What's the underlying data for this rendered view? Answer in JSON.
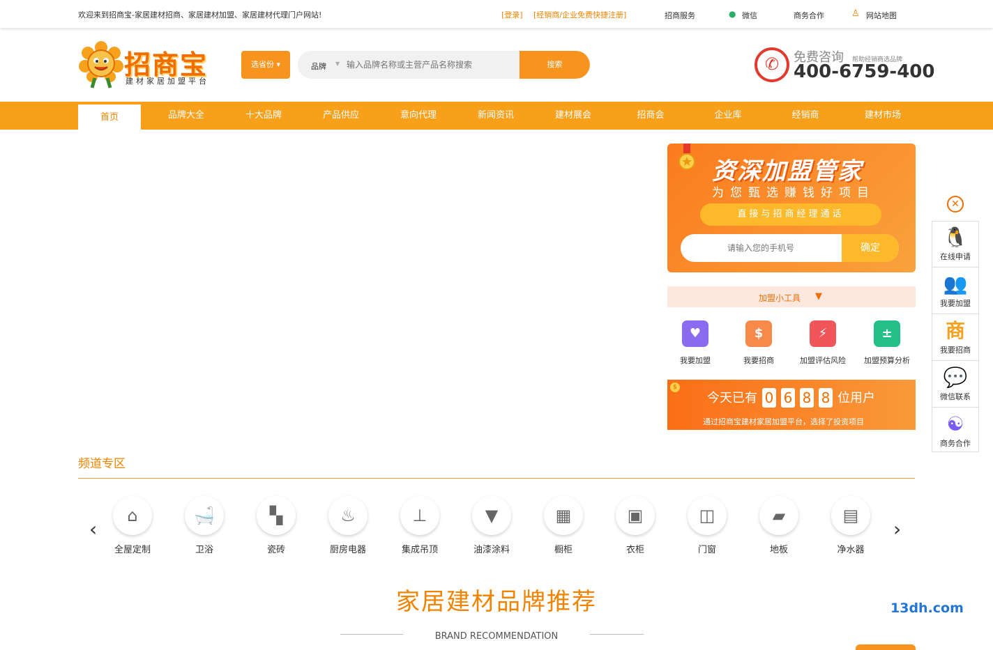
{
  "topbar": {
    "welcome": "欢迎来到招商宝-家居建材招商、家居建材加盟、家居建材代理门户网站!",
    "login": "[登录]",
    "register": "[经销商/企业免费快捷注册]",
    "service": "招商服务",
    "wechat": "微信",
    "business": "商务合作",
    "sitemap": "网站地图"
  },
  "logo": {
    "main": "招商宝",
    "sub": "建材家居加盟平台"
  },
  "search": {
    "province_label": "选省份 ▾",
    "category": "品牌",
    "placeholder": "输入品牌名称或主营产品名称搜索",
    "button": "搜索"
  },
  "hotline": {
    "label": "免费咨询",
    "slogan": "帮助经销商选品牌",
    "number": "400-6759-400"
  },
  "nav": [
    "首页",
    "品牌大全",
    "十大品牌",
    "产品供应",
    "意向代理",
    "新闻资讯",
    "建材展会",
    "招商会",
    "企业库",
    "经销商",
    "建材市场"
  ],
  "promo": {
    "title": "资深加盟管家",
    "subtitle": "为您甄选赚钱好项目",
    "pill": "直接与招商经理通话",
    "phone_placeholder": "请输入您的手机号",
    "confirm": "确定"
  },
  "tools": {
    "header": "加盟小工具",
    "items": [
      {
        "label": "我要加盟",
        "icon": "handshake-icon",
        "color": "#8b6cf0"
      },
      {
        "label": "我要招商",
        "icon": "money-bag-icon",
        "color": "#f7894a"
      },
      {
        "label": "加盟评估风险",
        "icon": "shield-icon",
        "color": "#f0555a"
      },
      {
        "label": "加盟预算分析",
        "icon": "calculator-icon",
        "color": "#25c08a"
      }
    ]
  },
  "counter": {
    "prefix": "今天已有",
    "digits": [
      "0",
      "6",
      "8",
      "8"
    ],
    "suffix": "位用户",
    "note": "通过招商宝建材家居加盟平台，选择了投资项目"
  },
  "sidebar": [
    {
      "label": "在线申请",
      "icon": "qq-penguin-icon"
    },
    {
      "label": "我要加盟",
      "icon": "group-icon"
    },
    {
      "label": "我要招商",
      "icon": "shang-char-icon"
    },
    {
      "label": "微信联系",
      "icon": "wechat-icon"
    },
    {
      "label": "商务合作",
      "icon": "cooperation-icon"
    }
  ],
  "channels": {
    "title": "频道专区",
    "items": [
      "全屋定制",
      "卫浴",
      "瓷砖",
      "厨房电器",
      "集成吊顶",
      "油漆涂料",
      "橱柜",
      "衣柜",
      "门窗",
      "地板",
      "净水器"
    ]
  },
  "recommend": {
    "title": "家居建材品牌推荐",
    "subtitle": "BRAND RECOMMENDATION"
  },
  "watermark": "13dh.com"
}
